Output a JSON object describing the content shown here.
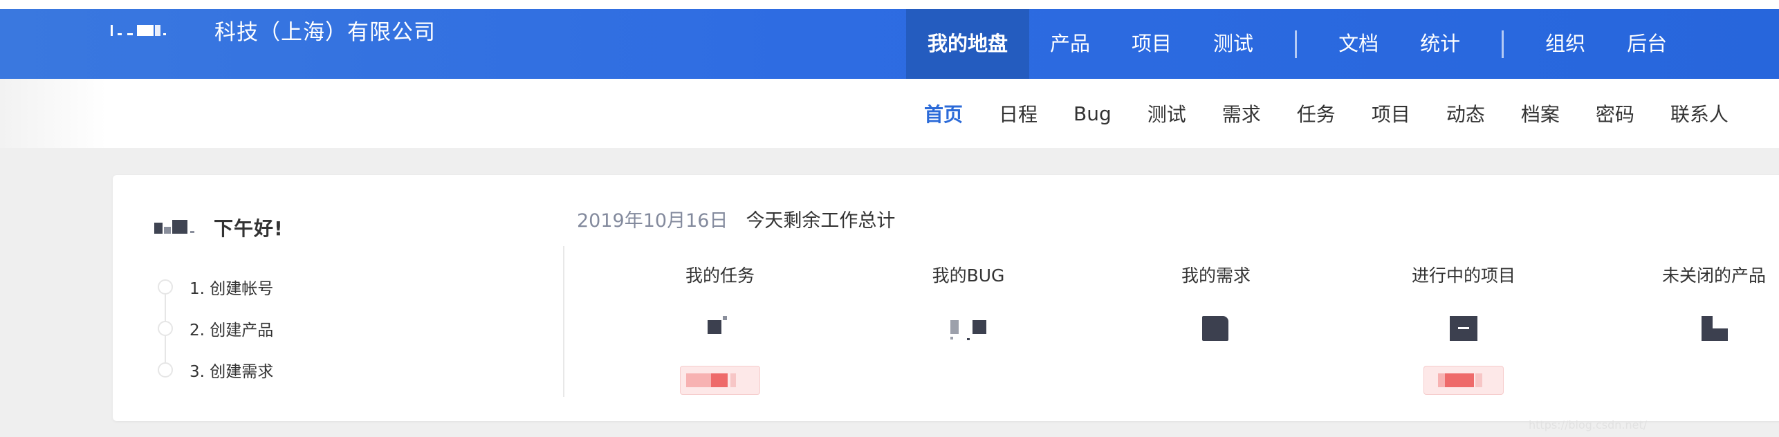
{
  "header": {
    "company": "科技（上海）有限公司",
    "nav": [
      {
        "label": "我的地盘",
        "active": true
      },
      {
        "label": "产品"
      },
      {
        "label": "项目"
      },
      {
        "label": "测试"
      },
      {
        "label": "文档"
      },
      {
        "label": "统计"
      },
      {
        "label": "组织"
      },
      {
        "label": "后台"
      }
    ]
  },
  "subnav": {
    "items": [
      {
        "label": "首页",
        "active": true
      },
      {
        "label": "日程"
      },
      {
        "label": "Bug"
      },
      {
        "label": "测试"
      },
      {
        "label": "需求"
      },
      {
        "label": "任务"
      },
      {
        "label": "项目"
      },
      {
        "label": "动态"
      },
      {
        "label": "档案"
      },
      {
        "label": "密码"
      },
      {
        "label": "联系人"
      }
    ]
  },
  "welcome": {
    "greeting": "下午好!",
    "steps": [
      "1. 创建帐号",
      "2. 创建产品",
      "3. 创建需求"
    ]
  },
  "summary": {
    "date": "2019年10月16日",
    "title": "今天剩余工作总计",
    "stats": [
      {
        "label": "我的任务",
        "icon": "redacted-count",
        "badge": true
      },
      {
        "label": "我的BUG",
        "icon": "redacted-count",
        "badge": false
      },
      {
        "label": "我的需求",
        "icon": "redacted-count",
        "badge": false
      },
      {
        "label": "进行中的项目",
        "icon": "redacted-count",
        "badge": true
      },
      {
        "label": "未关闭的产品",
        "icon": "redacted-count",
        "badge": false
      }
    ]
  },
  "colors": {
    "header_blue": "#2e6ce2",
    "active_nav_bg": "#245cbf",
    "subnav_active": "#2b6ad8",
    "badge_red": "#ee6a6a"
  }
}
